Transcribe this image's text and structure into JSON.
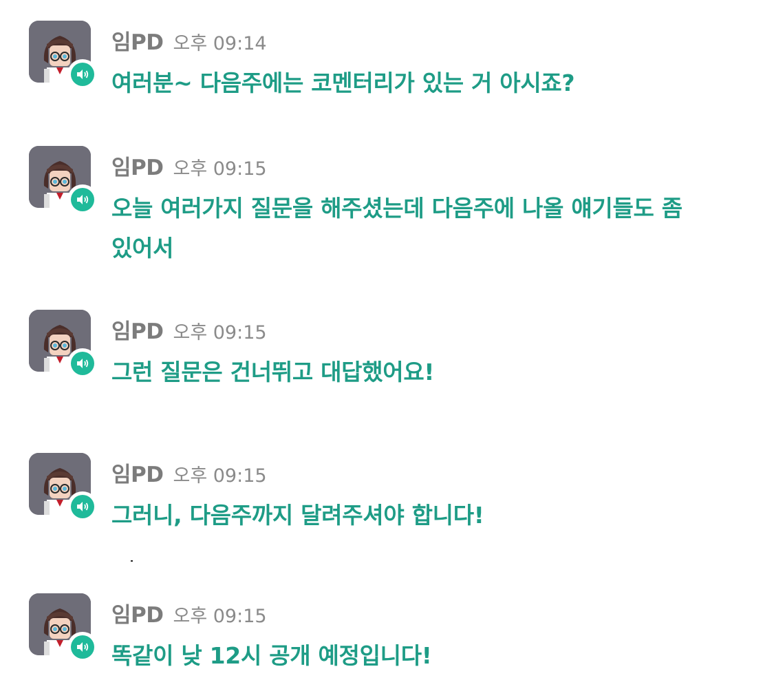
{
  "accent_color": "#1fba9a",
  "text_color": "#1e9c86",
  "messages": [
    {
      "sender": "임PD",
      "time": "오후 09:14",
      "text": "여러분~ 다음주에는 코멘터리가 있는 거 아시죠?",
      "avatar_icon": "character-avatar-icon",
      "badge_icon": "speaker-icon"
    },
    {
      "sender": "임PD",
      "time": "오후 09:15",
      "text": "오늘 여러가지 질문을 해주셨는데 다음주에 나올 얘기들도 좀 있어서",
      "avatar_icon": "character-avatar-icon",
      "badge_icon": "speaker-icon"
    },
    {
      "sender": "임PD",
      "time": "오후 09:15",
      "text": "그런 질문은 건너뛰고 대답했어요!",
      "avatar_icon": "character-avatar-icon",
      "badge_icon": "speaker-icon"
    },
    {
      "sender": "임PD",
      "time": "오후 09:15",
      "text": "그러니, 다음주까지 달려주셔야 합니다!",
      "avatar_icon": "character-avatar-icon",
      "badge_icon": "speaker-icon"
    },
    {
      "sender": "임PD",
      "time": "오후 09:15",
      "text": "똑같이 낮 12시 공개 예정입니다!",
      "avatar_icon": "character-avatar-icon",
      "badge_icon": "speaker-icon"
    }
  ]
}
